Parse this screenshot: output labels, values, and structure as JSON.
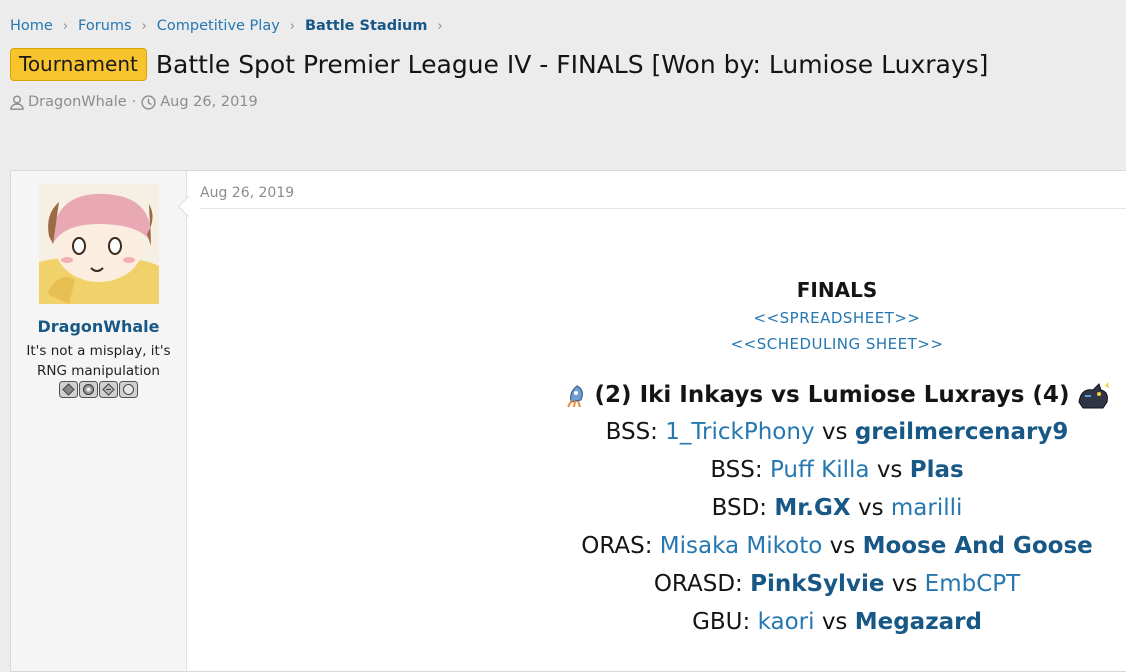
{
  "breadcrumb": [
    {
      "label": "Home"
    },
    {
      "label": "Forums"
    },
    {
      "label": "Competitive Play"
    },
    {
      "label": "Battle Stadium"
    }
  ],
  "thread": {
    "prefix": "Tournament",
    "title": "Battle Spot Premier League IV - FINALS [Won by: Lumiose Luxrays]",
    "author": "DragonWhale",
    "date": "Aug 26, 2019"
  },
  "post": {
    "date": "Aug 26, 2019",
    "user": {
      "name": "DragonWhale",
      "title": "It's not a misplay, it's RNG manipulation",
      "avatar_icon": "avatar-image",
      "badge_icons": [
        "badge-1-icon",
        "badge-2-icon",
        "badge-3-icon",
        "badge-4-icon"
      ]
    },
    "body": {
      "heading": "FINALS",
      "links": [
        "<<SPREADSHEET>>",
        "<<SCHEDULING SHEET>>"
      ],
      "matchup": {
        "team1": "(2) Iki Inkays",
        "vs": "vs",
        "team2": "Lumiose Luxrays (4)",
        "team1_icon": "inkay-sprite-icon",
        "team2_icon": "luxray-sprite-icon"
      },
      "matches": [
        {
          "format": "BSS:",
          "p1": "1_TrickPhony",
          "vs": "vs",
          "p2": "greilmercenary9",
          "winner": 2
        },
        {
          "format": "BSS:",
          "p1": "Puff Killa",
          "vs": "vs",
          "p2": "Plas",
          "winner": 2
        },
        {
          "format": "BSD:",
          "p1": "Mr.GX",
          "vs": "vs",
          "p2": "marilli",
          "winner": 1
        },
        {
          "format": "ORAS:",
          "p1": "Misaka Mikoto",
          "vs": "vs",
          "p2": "Moose And Goose",
          "winner": 2
        },
        {
          "format": "ORASD:",
          "p1": "PinkSylvie",
          "vs": "vs",
          "p2": "EmbCPT",
          "winner": 1
        },
        {
          "format": "GBU:",
          "p1": "kaori",
          "vs": "vs",
          "p2": "Megazard",
          "winner": 2
        }
      ]
    }
  },
  "colors": {
    "link": "#2577b1",
    "link_bold": "#185886",
    "prefix_bg": "#f8c42d",
    "page_bg": "#ececec"
  }
}
